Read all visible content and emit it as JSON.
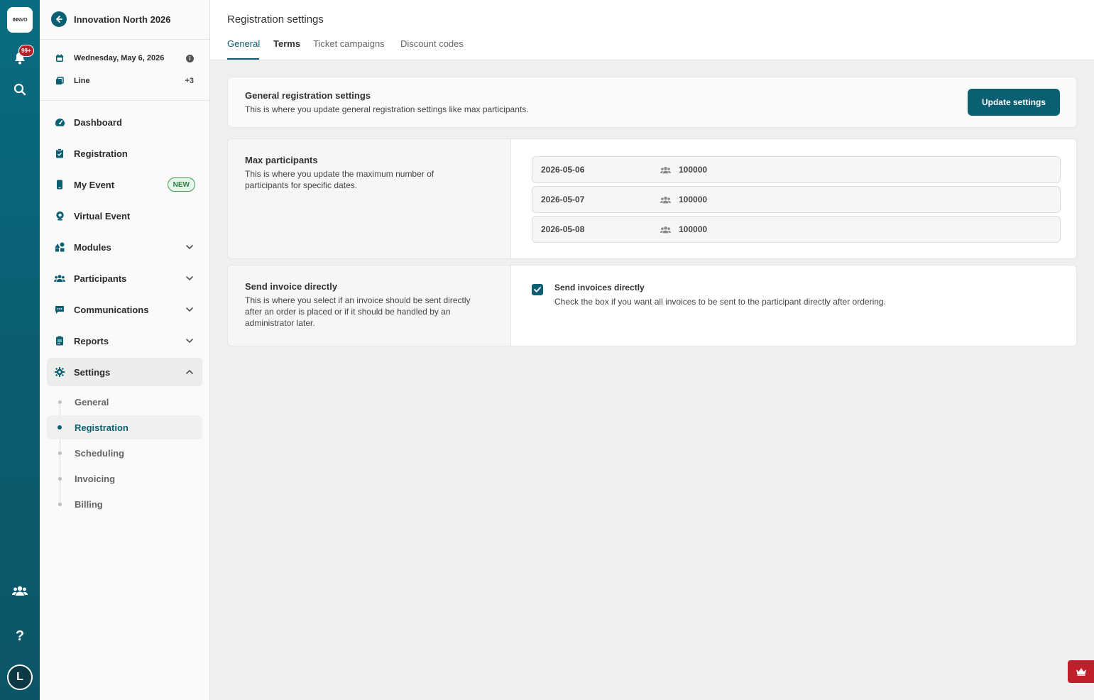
{
  "rail": {
    "logo_text": "INNVO",
    "notification_badge": "99+",
    "avatar_initial": "L",
    "icons": [
      "bell-icon",
      "search-icon",
      "people-icon",
      "help-icon"
    ]
  },
  "sidebar": {
    "event_title": "Innovation North 2026",
    "date": "Wednesday, May 6, 2026",
    "venue": "Line",
    "venue_extra": "+3",
    "nav": [
      {
        "label": "Dashboard",
        "icon": "gauge-icon"
      },
      {
        "label": "Registration",
        "icon": "clipboard-icon"
      },
      {
        "label": "My Event",
        "icon": "phone-icon",
        "badge": "NEW"
      },
      {
        "label": "Virtual Event",
        "icon": "webcam-icon"
      },
      {
        "label": "Modules",
        "icon": "shapes-icon"
      },
      {
        "label": "Participants",
        "icon": "users-icon"
      },
      {
        "label": "Communications",
        "icon": "chat-icon"
      },
      {
        "label": "Reports",
        "icon": "report-icon"
      },
      {
        "label": "Settings",
        "icon": "gear-icon"
      }
    ],
    "settings_sub": [
      {
        "label": "General"
      },
      {
        "label": "Registration"
      },
      {
        "label": "Scheduling"
      },
      {
        "label": "Invoicing"
      },
      {
        "label": "Billing"
      }
    ]
  },
  "header": {
    "title": "Registration settings",
    "tabs": [
      {
        "label": "General"
      },
      {
        "label": "Terms"
      },
      {
        "label": "Ticket campaigns"
      },
      {
        "label": "Discount codes"
      }
    ]
  },
  "intro": {
    "title": "General registration settings",
    "description": "This is where you update general registration settings like max participants.",
    "button": "Update settings"
  },
  "max_participants": {
    "title": "Max participants",
    "description_line1": "This is where you update the maximum number of",
    "description_line2": "participants for specific dates.",
    "rows": [
      {
        "date": "2026-05-06",
        "value": "100000"
      },
      {
        "date": "2026-05-07",
        "value": "100000"
      },
      {
        "date": "2026-05-08",
        "value": "100000"
      }
    ]
  },
  "invoice": {
    "title": "Send invoice directly",
    "description_line1": "This is where you select if an invoice should be sent directly",
    "description_line2": "after an order is placed or if it should be handled by an",
    "description_line3": "administrator later.",
    "checkbox_checked": true,
    "checkbox_label": "Send invoices directly",
    "checkbox_help": "Check the box if you want all invoices to be sent to the participant directly after ordering."
  },
  "colors": {
    "primary": "#0b5f73",
    "badge_red": "#b3202a",
    "new_green": "#2c7f42"
  }
}
